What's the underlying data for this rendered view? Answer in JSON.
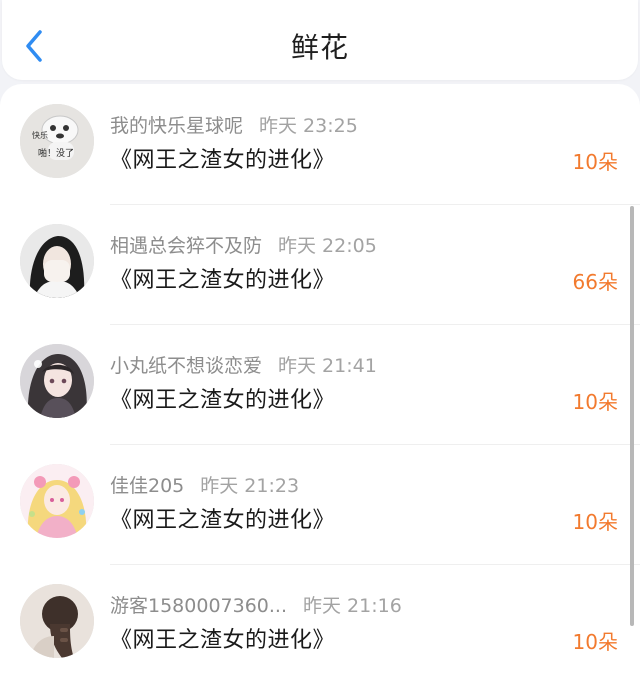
{
  "header": {
    "title": "鲜花",
    "back_icon": "chevron-left-icon",
    "accent_color": "#2f8cf2"
  },
  "list": {
    "items": [
      {
        "user": "我的快乐星球呢",
        "time": "昨天 23:25",
        "book": "《网王之渣女的进化》",
        "count": "10朵",
        "avatar_text_top": "快乐",
        "avatar_text_bottom": "啪！没了"
      },
      {
        "user": "相遇总会猝不及防",
        "time": "昨天 22:05",
        "book": "《网王之渣女的进化》",
        "count": "66朵"
      },
      {
        "user": "小丸纸不想谈恋爱",
        "time": "昨天 21:41",
        "book": "《网王之渣女的进化》",
        "count": "10朵"
      },
      {
        "user": "佳佳205",
        "time": "昨天 21:23",
        "book": "《网王之渣女的进化》",
        "count": "10朵"
      },
      {
        "user": "游客1580007360...",
        "time": "昨天 21:16",
        "book": "《网王之渣女的进化》",
        "count": "10朵"
      }
    ]
  },
  "colors": {
    "count": "#f27a2e",
    "username": "#8d8d8d",
    "book": "#1a1a1a"
  }
}
